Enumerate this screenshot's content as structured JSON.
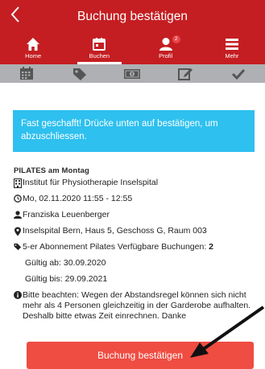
{
  "header": {
    "title": "Buchung bestätigen"
  },
  "nav": {
    "items": [
      {
        "label": "Home"
      },
      {
        "label": "Buchen"
      },
      {
        "label": "Profil",
        "badge": "2"
      },
      {
        "label": "Mehr"
      }
    ]
  },
  "steps": [
    "calendar",
    "tag",
    "money",
    "edit",
    "check"
  ],
  "banner": {
    "text": "Fast geschafft! Drücke unten auf bestätigen, um abzuschliessen."
  },
  "booking": {
    "title": "PILATES am Montag",
    "institute": "Institut für Physiotherapie Inselspital",
    "datetime": "Mo, 02.11.2020 11:55 - 12:55",
    "instructor": "Franziska Leuenberger",
    "location": "Inselspital Bern, Haus 5, Geschoss G, Raum 003",
    "subscription_label": "5-er Abonnement Pilates Verfügbare Buchungen: ",
    "subscription_count": "2",
    "valid_from": "Gültig ab: 30.09.2020",
    "valid_until": "Gültig bis: 29.09.2021",
    "notice": "Bitte beachten: Wegen der Abstandsregel können sich nicht mehr als 4 Personen gleichzeitig in der Garderobe aufhalten. Deshalb bitte etwas Zeit einrechnen. Danke"
  },
  "confirm_button": {
    "label": "Buchung bestätigen"
  },
  "colors": {
    "primary": "#c41e22",
    "banner": "#2ec0ef",
    "button": "#ef4c42",
    "steps": "#aeb0b3"
  }
}
